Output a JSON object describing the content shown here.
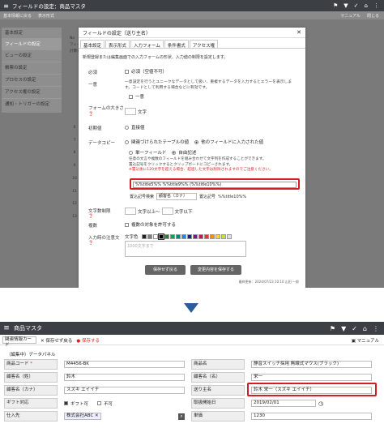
{
  "top": {
    "title": "フィールドの設定：商品マスタ",
    "manual": "マニュアル",
    "close": "閉じる"
  },
  "top_tabs": [
    "基本情報に戻る",
    "表示形式"
  ],
  "sidebar": {
    "items": [
      "基本設定",
      "フィールドの設定",
      "ビューの設定",
      "帳票の設定",
      "プロセスの設定",
      "アクセス権の設定",
      "通知・トリガーの設定"
    ]
  },
  "bg_col": [
    "No",
    "フィールド",
    "計算式"
  ],
  "dialog": {
    "title": "フィールドの設定（送り主名）",
    "tabs": [
      "基本設定",
      "表示形式",
      "入力フォーム",
      "条件書式",
      "アクセス権"
    ],
    "intro": "新規登録または編集画面での入力フォームの形状、入力値の制限を設定します。",
    "required_label": "必須",
    "required_opt": "必須（空値不可）",
    "unique_label": "一意",
    "unique_desc1": "一意設定を行うとユニークなデータとして扱い、重複するデータを入力するとエラーを表示します。コードとして利用する場合などに有効です。",
    "unique_opt": "一意",
    "size_label": "フォームの大きさ",
    "size_unit": "文字",
    "init_label": "初期値",
    "init_opt": "直接値",
    "copy_label": "データコピー",
    "copy_opt1": "関連づけられたテーブルの値",
    "copy_opt2": "他のフィールドに入力された値",
    "single_opt": "単一フィールド",
    "multi_opt": "自由記述",
    "desc1": "任意の文言や複数のフィールドを組み合わせて文字列を作成することができます。",
    "desc2": "置込記号をクリックするとクリップボードにコピーされます。",
    "desc3": "※置込後に120文字を超える場合、超過した文字は削除されますのでご注意ください。",
    "copy_value": "%%title5%% %%title9%% (%%title10%%)",
    "sym_label1": "置込記号検索",
    "sym_input": "顧客名（カナ）",
    "sym_label2": "置込記号",
    "sym_value": "%%title10%%",
    "len_label": "文字数制限",
    "len_mid": "文字以上～",
    "len_end": "文字以下",
    "multi_label": "複数",
    "multi_opt_text": "複数の対象を許可する",
    "style_label": "入力時の注意文",
    "color_label": "文字色",
    "hint_placeholder": "1000文字まで",
    "save": "保存せず戻る",
    "save2": "変更内容を保存する",
    "footer": "最終更新：2024/07/23 10:10 山田 一郎"
  },
  "record": {
    "title": "商品マスタ",
    "select": "関連情報カード",
    "save_back": "保存せず戻る",
    "save": "保存する",
    "manual": "マニュアル",
    "section": "（編集中）データパネル",
    "fields": [
      {
        "label": "商品コード",
        "value": "M4456-BK",
        "req": true
      },
      {
        "label": "商品名",
        "value": "静音スイッチ採用 無線式マウス(ブラック)",
        "req": false
      },
      {
        "label": "顧客名（姓）",
        "value": "鈴木",
        "req": false
      },
      {
        "label": "顧客名（名）",
        "value": "栄一",
        "req": false
      },
      {
        "label": "顧客名（カナ）",
        "value": "スズキ エイイチ",
        "req": false
      },
      {
        "label": "送り主名",
        "value": "鈴木 栄一（スズキ エイイチ）",
        "req": false
      },
      {
        "label": "ギフト対応",
        "value": "ギフト可",
        "value2": "不可",
        "req": false
      },
      {
        "label": "取扱開始日",
        "value": "2019/02/01",
        "req": false
      },
      {
        "label": "仕入先",
        "value": "株式会社ABC",
        "req": false
      },
      {
        "label": "単価",
        "value": "1230",
        "req": false
      }
    ]
  },
  "palette": [
    "#222222",
    "#7f7f7f",
    "#ffffff",
    "#000000",
    "#2e7d32",
    "#00a652",
    "#00897b",
    "#1e88e5",
    "#1a237e",
    "#6a1b9a",
    "#c2185b",
    "#e53935",
    "#fb8c00",
    "#fdd835",
    "#cddc39",
    "#e0e0e0"
  ],
  "colors": {
    "dark": "#3c3f44",
    "accent": "#d21f26",
    "blue": "#4285f4"
  }
}
